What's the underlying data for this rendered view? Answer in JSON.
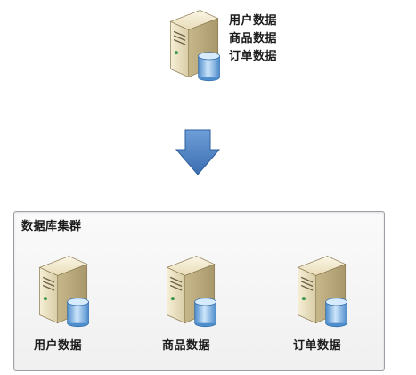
{
  "source_server": {
    "labels": [
      "用户数据",
      "商品数据",
      "订单数据"
    ]
  },
  "cluster": {
    "title": "数据库集群",
    "nodes": [
      {
        "label": "用户数据"
      },
      {
        "label": "商品数据"
      },
      {
        "label": "订单数据"
      }
    ]
  },
  "colors": {
    "arrow": "#4a7fc1",
    "server_body": "#efe6c9",
    "cylinder": "#6ea8dc",
    "cluster_border": "#9aa0a6"
  },
  "icons": {
    "server": "database-server-icon",
    "arrow": "arrow-down-icon"
  }
}
